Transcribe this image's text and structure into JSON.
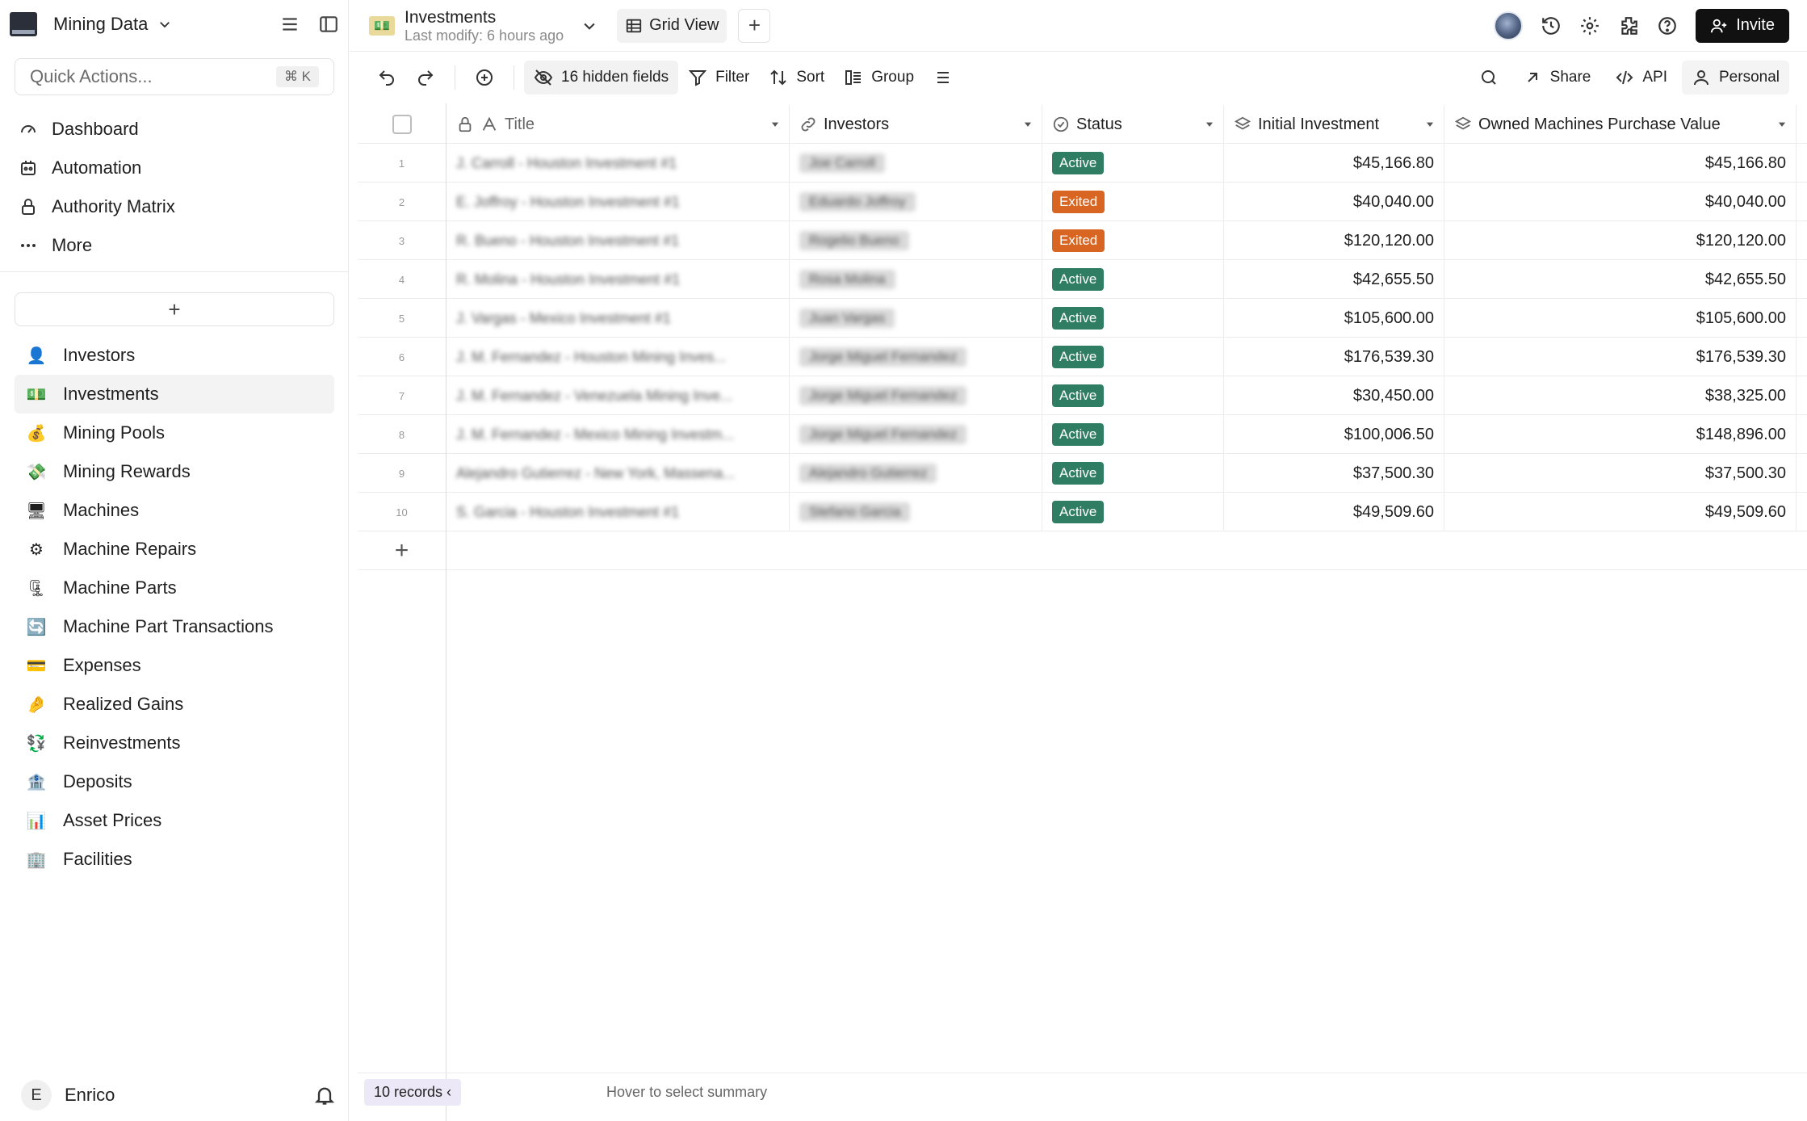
{
  "workspace": {
    "name": "Mining Data"
  },
  "quick_actions": {
    "placeholder": "Quick Actions...",
    "shortcut": "⌘ K"
  },
  "nav": [
    {
      "label": "Dashboard",
      "icon": "dashboard-icon"
    },
    {
      "label": "Automation",
      "icon": "automation-icon"
    },
    {
      "label": "Authority Matrix",
      "icon": "lock-icon"
    },
    {
      "label": "More",
      "icon": "more-icon"
    }
  ],
  "add_table_label": "+",
  "tables": [
    {
      "label": "Investors",
      "emoji": "👤"
    },
    {
      "label": "Investments",
      "emoji": "💵",
      "active": true
    },
    {
      "label": "Mining Pools",
      "emoji": "💰"
    },
    {
      "label": "Mining Rewards",
      "emoji": "💸"
    },
    {
      "label": "Machines",
      "emoji": "🖥"
    },
    {
      "label": "Machine Repairs",
      "emoji": "⚙"
    },
    {
      "label": "Machine Parts",
      "emoji": "🗜"
    },
    {
      "label": "Machine Part Transactions",
      "emoji": "🔄"
    },
    {
      "label": "Expenses",
      "emoji": "💳"
    },
    {
      "label": "Realized Gains",
      "emoji": "🤌"
    },
    {
      "label": "Reinvestments",
      "emoji": "💱"
    },
    {
      "label": "Deposits",
      "emoji": "🏦"
    },
    {
      "label": "Asset Prices",
      "emoji": "📊"
    },
    {
      "label": "Facilities",
      "emoji": "🏢"
    }
  ],
  "user": {
    "initial": "E",
    "name": "Enrico"
  },
  "topbar": {
    "title": "Investments",
    "subtitle": "Last modify: 6 hours ago",
    "view_label": "Grid View",
    "invite_label": "Invite"
  },
  "toolbar": {
    "hidden_fields": "16 hidden fields",
    "filter": "Filter",
    "sort": "Sort",
    "group": "Group",
    "share": "Share",
    "api": "API",
    "personal": "Personal"
  },
  "grid": {
    "columns": [
      "Title",
      "Investors",
      "Status",
      "Initial Investment",
      "Owned Machines Purchase Value"
    ],
    "rows": [
      {
        "n": "1",
        "title": "J. Carroll - Houston Investment #1",
        "investor": "Joe Carroll",
        "status": "Active",
        "initial": "$45,166.80",
        "owned": "$45,166.80"
      },
      {
        "n": "2",
        "title": "E. Joffroy - Houston Investment #1",
        "investor": "Eduardo Joffroy",
        "status": "Exited",
        "initial": "$40,040.00",
        "owned": "$40,040.00"
      },
      {
        "n": "3",
        "title": "R. Bueno - Houston Investment #1",
        "investor": "Rogelio Bueno",
        "status": "Exited",
        "initial": "$120,120.00",
        "owned": "$120,120.00"
      },
      {
        "n": "4",
        "title": "R. Molina - Houston Investment #1",
        "investor": "Rosa Molina",
        "status": "Active",
        "initial": "$42,655.50",
        "owned": "$42,655.50"
      },
      {
        "n": "5",
        "title": "J. Vargas - Mexico Investment #1",
        "investor": "Juan Vargas",
        "status": "Active",
        "initial": "$105,600.00",
        "owned": "$105,600.00"
      },
      {
        "n": "6",
        "title": "J. M. Fernandez - Houston Mining Inves...",
        "investor": "Jorge Miguel Fernandez",
        "status": "Active",
        "initial": "$176,539.30",
        "owned": "$176,539.30"
      },
      {
        "n": "7",
        "title": "J. M. Fernandez - Venezuela Mining Inve...",
        "investor": "Jorge Miguel Fernandez",
        "status": "Active",
        "initial": "$30,450.00",
        "owned": "$38,325.00"
      },
      {
        "n": "8",
        "title": "J. M. Fernandez - Mexico Mining Investm...",
        "investor": "Jorge Miguel Fernandez",
        "status": "Active",
        "initial": "$100,006.50",
        "owned": "$148,896.00"
      },
      {
        "n": "9",
        "title": "Alejandro Gutierrez - New York, Massena...",
        "investor": "Alejandro Gutierrez",
        "status": "Active",
        "initial": "$37,500.30",
        "owned": "$37,500.30"
      },
      {
        "n": "10",
        "title": "S. Garcia - Houston Investment #1",
        "investor": "Stefano Garcia",
        "status": "Active",
        "initial": "$49,509.60",
        "owned": "$49,509.60"
      }
    ]
  },
  "footer": {
    "records": "10 records",
    "summary": "Hover to select summary"
  },
  "colors": {
    "active": "#2f7d63",
    "exited": "#d96523",
    "invite_bg": "#111111"
  }
}
